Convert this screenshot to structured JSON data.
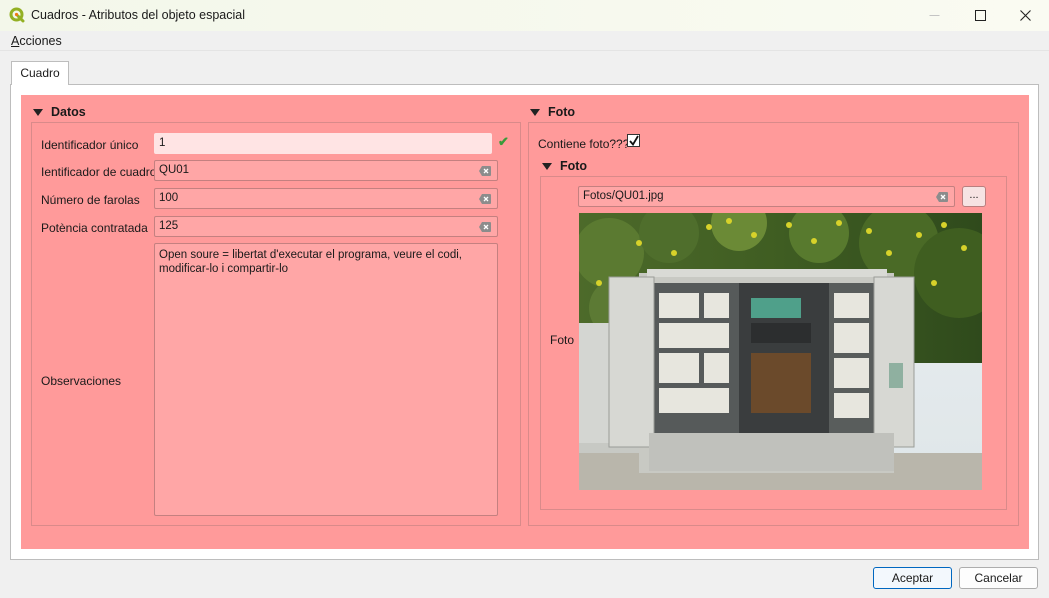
{
  "window": {
    "title": "Cuadros - Atributos del objeto espacial",
    "controls": [
      "minimize",
      "maximize",
      "close"
    ]
  },
  "menu": {
    "accion_accel": "A",
    "accion_rest": "cciones"
  },
  "tabs": [
    {
      "label": "Cuadro"
    }
  ],
  "datos": {
    "title": "Datos",
    "fields": [
      {
        "label": "Identificador únic",
        "label_rest": "o",
        "value": "1"
      },
      {
        "label": "Ientificador de cuadro",
        "value": "QU01"
      },
      {
        "label": "Número de farolas",
        "value": "100"
      },
      {
        "label": "Potència contratada",
        "value": "125"
      }
    ],
    "observaciones": {
      "label": "Observaciones",
      "value": "Open soure = libertat d'executar el programa, veure el codi,\nmodificar-lo i compartir-lo"
    }
  },
  "foto": {
    "title": "Foto",
    "contiene_label": "Contiene foto???",
    "contiene_checked": true,
    "inner_title": "Foto",
    "path_value": "Fotos/QU01.jpg",
    "browse_label": "...",
    "image_label": "Foto"
  },
  "buttons": {
    "accept": "Aceptar",
    "cancel": "Cancelar"
  },
  "colors": {
    "form_background": "#ff9a9a",
    "field_background": "#ffa6a6",
    "valid_check": "#3a9a3a",
    "logo": "#93b023"
  }
}
